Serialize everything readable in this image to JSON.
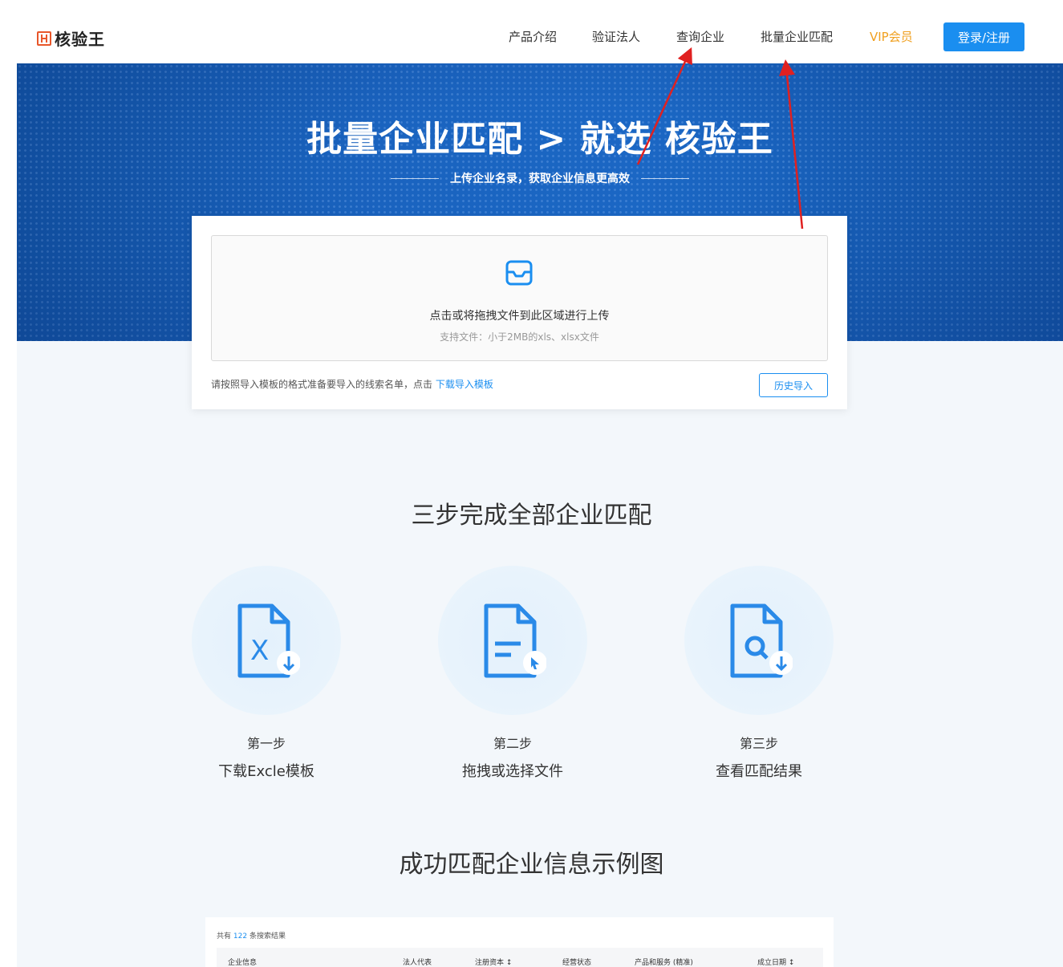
{
  "nav": {
    "logo": "核验王",
    "links": [
      "产品介绍",
      "验证法人",
      "查询企业",
      "批量企业匹配",
      "VIP会员"
    ],
    "login": "登录/注册"
  },
  "banner": {
    "title": "批量企业匹配 > 就选 核验王",
    "subtitle": "上传企业名录，获取企业信息更高效"
  },
  "upload": {
    "drop_text": "点击或将拖拽文件到此区域进行上传",
    "drop_hint": "支持文件：小于2MB的xls、xlsx文件",
    "tip": "请按照导入模板的格式准备要导入的线索名单，点击",
    "tip_link": "下载导入模板",
    "history": "历史导入"
  },
  "steps_section": {
    "title": "三步完成全部企业匹配",
    "steps": [
      {
        "label": "第一步",
        "desc": "下载Excle模板",
        "icon": "excel-download-icon"
      },
      {
        "label": "第二步",
        "desc": "拖拽或选择文件",
        "icon": "file-select-icon"
      },
      {
        "label": "第三步",
        "desc": "查看匹配结果",
        "icon": "file-search-icon"
      }
    ]
  },
  "example_section": {
    "title": "成功匹配企业信息示例图",
    "count_prefix": "共有",
    "count": "122",
    "count_suffix": "条搜索结果",
    "columns": [
      "企业信息",
      "法人代表",
      "注册资本 ↕",
      "经营状态",
      "产品和服务 (精准)",
      "成立日期 ↕"
    ]
  },
  "colors": {
    "accent": "#1a8ef0",
    "vip": "#f0a020",
    "banner": "#1a63bf",
    "annotation": "#e02020"
  }
}
